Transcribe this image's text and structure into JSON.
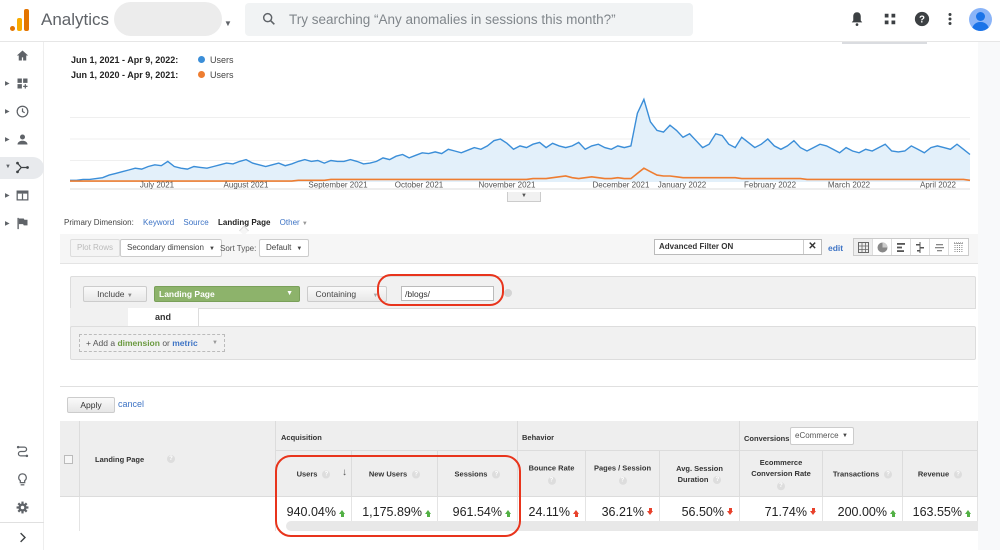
{
  "app": {
    "title": "Analytics",
    "search_placeholder": "Try searching “Any anomalies in sessions this month?”"
  },
  "topbar_icons": [
    "bell-icon",
    "apps-grid-icon",
    "help-icon",
    "more-vert-icon",
    "account-avatar"
  ],
  "sidebar": {
    "items": [
      {
        "name": "home",
        "icon": "home-icon",
        "expandable": false
      },
      {
        "name": "customization",
        "icon": "dashboard-add-icon",
        "expandable": true
      },
      {
        "name": "realtime",
        "icon": "clock-icon",
        "expandable": true
      },
      {
        "name": "audience",
        "icon": "person-icon",
        "expandable": true
      },
      {
        "name": "acquisition",
        "icon": "acquisition-icon",
        "expandable": true,
        "active": true
      },
      {
        "name": "behavior",
        "icon": "behavior-icon",
        "expandable": true
      },
      {
        "name": "conversions",
        "icon": "flag-icon",
        "expandable": true
      }
    ],
    "bottom": [
      {
        "name": "attribution",
        "icon": "attribution-icon"
      },
      {
        "name": "discover",
        "icon": "lightbulb-icon"
      },
      {
        "name": "admin",
        "icon": "gear-icon"
      },
      {
        "name": "collapse",
        "icon": "chevron-right-icon"
      }
    ]
  },
  "legend": {
    "current_range": "Jun 1, 2021 - Apr 9, 2022:",
    "current_metric": "Users",
    "previous_range": "Jun 1, 2020 - Apr 9, 2021:",
    "previous_metric": "Users",
    "current_color": "#3b8ed8",
    "previous_color": "#ee7d31"
  },
  "chart_data": {
    "type": "line",
    "title": "",
    "xlabel": "",
    "ylabel": "",
    "x_ticks": [
      "July 2021",
      "August 2021",
      "September 2021",
      "October 2021",
      "November 2021",
      "December 2021",
      "January 2022",
      "February 2022",
      "March 2022",
      "April 2022"
    ],
    "ylim": [
      0,
      100
    ],
    "grid": true,
    "series": [
      {
        "name": "Users (Jun 1, 2021 - Apr 9, 2022)",
        "color": "#3b8ed8",
        "area": true,
        "values": [
          2,
          2,
          3,
          3,
          4,
          5,
          8,
          10,
          12,
          14,
          16,
          15,
          18,
          20,
          19,
          24,
          18,
          16,
          15,
          18,
          17,
          16,
          18,
          20,
          22,
          21,
          24,
          26,
          22,
          20,
          18,
          20,
          22,
          19,
          21,
          24,
          26,
          24,
          25,
          22,
          25,
          24,
          24,
          26,
          24,
          21,
          22,
          24,
          28,
          26,
          30,
          32,
          28,
          31,
          34,
          33,
          35,
          33,
          38,
          36,
          34,
          37,
          40,
          38,
          42,
          48,
          50,
          45,
          38,
          42,
          40,
          44,
          46,
          40,
          45,
          42,
          40,
          42,
          46,
          38,
          42,
          44,
          40,
          38,
          42,
          40,
          42,
          80,
          96,
          70,
          60,
          58,
          66,
          60,
          52,
          56,
          48,
          40,
          44,
          56,
          54,
          44,
          40,
          52,
          46,
          40,
          44,
          50,
          42,
          38,
          42,
          48,
          40,
          36,
          40,
          44,
          42,
          38,
          34,
          40,
          36,
          34,
          38,
          36,
          40,
          44,
          36,
          35,
          36,
          42,
          38,
          34,
          40,
          42,
          40,
          38,
          44,
          38,
          32
        ]
      },
      {
        "name": "Users (Jun 1, 2020 - Apr 9, 2021)",
        "color": "#ee7d31",
        "area": false,
        "values": [
          1,
          1,
          1,
          1,
          1,
          1,
          1,
          1,
          1,
          1,
          1,
          1,
          1,
          1,
          1,
          1,
          1,
          1,
          1,
          1,
          1,
          1,
          1,
          1,
          1,
          1,
          1,
          1,
          1,
          1,
          1,
          1,
          1,
          1,
          1,
          2,
          2,
          2,
          2,
          2,
          3,
          3,
          3,
          3,
          3,
          3,
          3,
          3,
          3,
          3,
          3,
          3,
          3,
          3,
          3,
          3,
          3,
          3,
          3,
          3,
          3,
          3,
          3,
          3,
          3,
          3,
          3,
          3,
          3,
          3,
          3,
          4,
          4,
          4,
          5,
          6,
          7,
          5,
          4,
          5,
          6,
          5,
          4,
          4,
          5,
          4,
          4,
          10,
          16,
          12,
          8,
          7,
          7,
          6,
          5,
          5,
          5,
          5,
          5,
          5,
          5,
          5,
          5,
          4,
          4,
          4,
          4,
          4,
          4,
          4,
          4,
          4,
          4,
          3,
          3,
          3,
          3,
          3,
          3,
          3,
          3,
          3,
          3,
          3,
          3,
          3,
          3,
          3,
          3,
          3,
          3,
          3,
          3,
          3,
          3,
          3,
          3,
          3,
          2
        ]
      }
    ]
  },
  "primary_dimension": {
    "label": "Primary Dimension:",
    "options": [
      "Keyword",
      "Source",
      "Landing Page",
      "Other"
    ],
    "selected": "Landing Page"
  },
  "toolbar": {
    "plot_rows": "Plot Rows",
    "secondary_dimension": "Secondary dimension",
    "sort_type_label": "Sort Type:",
    "sort_type_value": "Default",
    "advanced_filter_value": "Advanced Filter ON",
    "edit_label": "edit",
    "view_buttons": [
      "table-view-icon",
      "pie-view-icon",
      "performance-view-icon",
      "comparison-view-icon",
      "term-cloud-icon",
      "pivot-view-icon"
    ]
  },
  "filter": {
    "include_label": "Include",
    "dimension_label": "Landing Page",
    "match_label": "Containing",
    "value": "/blogs/",
    "and_label": "and",
    "add_prefix": "+ Add a ",
    "add_dimension": "dimension",
    "add_or": " or ",
    "add_metric": "metric",
    "apply_label": "Apply",
    "cancel_label": "cancel"
  },
  "table": {
    "landing_page_header": "Landing Page",
    "groups": {
      "acquisition": "Acquisition",
      "behavior": "Behavior",
      "conversions": "Conversions",
      "conversions_select": "eCommerce"
    },
    "columns": [
      {
        "label": "Users",
        "value": "940.04%",
        "trend": "up"
      },
      {
        "label": "New Users",
        "value": "1,175.89%",
        "trend": "up"
      },
      {
        "label": "Sessions",
        "value": "961.54%",
        "trend": "up"
      },
      {
        "label": "Bounce Rate",
        "value": "24.11%",
        "trend": "up-bad"
      },
      {
        "label": "Pages / Session",
        "value": "36.21%",
        "trend": "down"
      },
      {
        "label": "Avg. Session Duration",
        "value": "56.50%",
        "trend": "down"
      },
      {
        "label": "Ecommerce Conversion Rate",
        "value": "71.74%",
        "trend": "down"
      },
      {
        "label": "Transactions",
        "value": "200.00%",
        "trend": "up"
      },
      {
        "label": "Revenue",
        "value": "163.55%",
        "trend": "up"
      }
    ]
  }
}
